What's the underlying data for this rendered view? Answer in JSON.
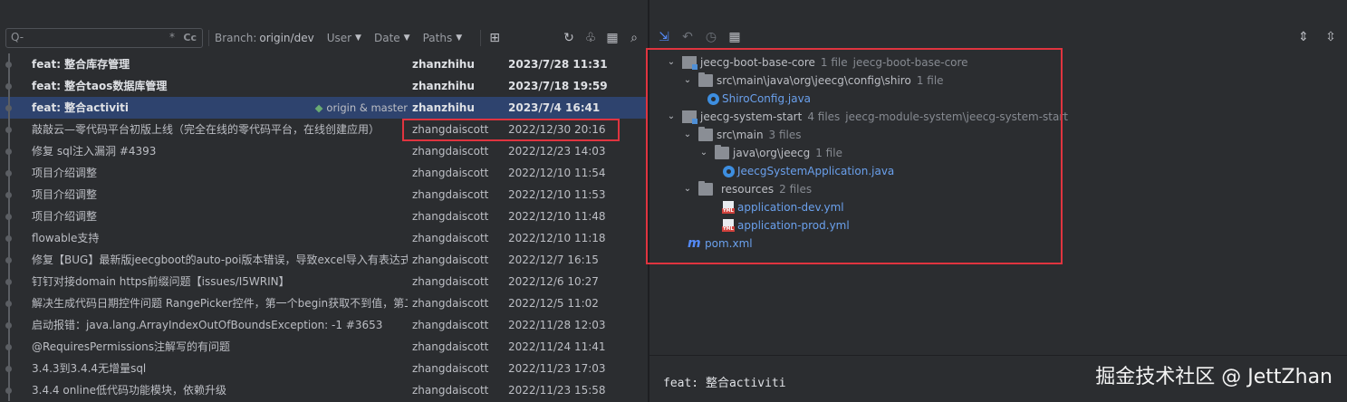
{
  "toolbar": {
    "search_placeholder": "Q-",
    "regex_symbol": "*",
    "case_symbol": "Cc",
    "branch_label": "Branch:",
    "branch_value": "origin/dev",
    "user_label": "User",
    "date_label": "Date",
    "paths_label": "Paths"
  },
  "commits": [
    {
      "subject": "feat: 整合库存管理",
      "author": "zhanzhihu",
      "date": "2023/7/28 11:31",
      "bold": true
    },
    {
      "subject": "feat: 整合taos数据库管理",
      "author": "zhanzhihu",
      "date": "2023/7/18 19:59",
      "bold": true
    },
    {
      "subject": "feat: 整合activiti",
      "author": "zhanzhihu",
      "date": "2023/7/4 16:41",
      "bold": true,
      "selected": true,
      "tags": "origin & master"
    },
    {
      "subject": "敲敲云—零代码平台初版上线（完全在线的零代码平台，在线创建应用）",
      "author": "zhangdaiscott",
      "date": "2022/12/30 20:16"
    },
    {
      "subject": "修复 sql注入漏洞 #4393",
      "author": "zhangdaiscott",
      "date": "2022/12/23 14:03"
    },
    {
      "subject": "项目介绍调整",
      "author": "zhangdaiscott",
      "date": "2022/12/10 11:54"
    },
    {
      "subject": "项目介绍调整",
      "author": "zhangdaiscott",
      "date": "2022/12/10 11:53"
    },
    {
      "subject": "项目介绍调整",
      "author": "zhangdaiscott",
      "date": "2022/12/10 11:48"
    },
    {
      "subject": "flowable支持",
      "author": "zhangdaiscott",
      "date": "2022/12/10 11:18"
    },
    {
      "subject": "修复【BUG】最新版jeecgboot的auto-poi版本错误，导致excel导入有表达式(",
      "author": "zhangdaiscott",
      "date": "2022/12/7 16:15"
    },
    {
      "subject": "钉钉对接domain https前缀问题【issues/I5WRIN】",
      "author": "zhangdaiscott",
      "date": "2022/12/6 10:27"
    },
    {
      "subject": "解决生成代码日期控件问题 RangePicker控件，第一个begin获取不到值，第二",
      "author": "zhangdaiscott",
      "date": "2022/12/5 11:02"
    },
    {
      "subject": "启动报错：java.lang.ArrayIndexOutOfBoundsException: -1 #3653",
      "author": "zhangdaiscott",
      "date": "2022/11/28 12:03"
    },
    {
      "subject": "@RequiresPermissions注解写的有问题",
      "author": "zhangdaiscott",
      "date": "2022/11/24 11:41"
    },
    {
      "subject": "3.4.3到3.4.4无增量sql",
      "author": "zhangdaiscott",
      "date": "2022/11/23 17:03"
    },
    {
      "subject": "3.4.4 online低代码功能模块，依赖升级",
      "author": "zhangdaiscott",
      "date": "2022/11/23 15:58"
    }
  ],
  "tree": {
    "n1": {
      "name": "jeecg-boot-base-core",
      "count": "1 file",
      "path": "jeecg-boot-base-core"
    },
    "n2": {
      "name": "src\\main\\java\\org\\jeecg\\config\\shiro",
      "count": "1 file"
    },
    "n3": {
      "name": "ShiroConfig.java"
    },
    "n4": {
      "name": "jeecg-system-start",
      "count": "4 files",
      "path": "jeecg-module-system\\jeecg-system-start"
    },
    "n5": {
      "name": "src\\main",
      "count": "3 files"
    },
    "n6": {
      "name": "java\\org\\jeecg",
      "count": "1 file"
    },
    "n7": {
      "name": "JeecgSystemApplication.java"
    },
    "n8": {
      "name": "resources",
      "count": "2 files"
    },
    "n9": {
      "name": "application-dev.yml"
    },
    "n10": {
      "name": "application-prod.yml"
    },
    "n11": {
      "name": "pom.xml"
    }
  },
  "detail": {
    "message": "feat: 整合activiti"
  },
  "watermark": "掘金技术社区 @ JettZhan",
  "colors": {
    "accent": "#548af7",
    "highlight": "#e0343f",
    "selected_row": "#2e436e"
  }
}
